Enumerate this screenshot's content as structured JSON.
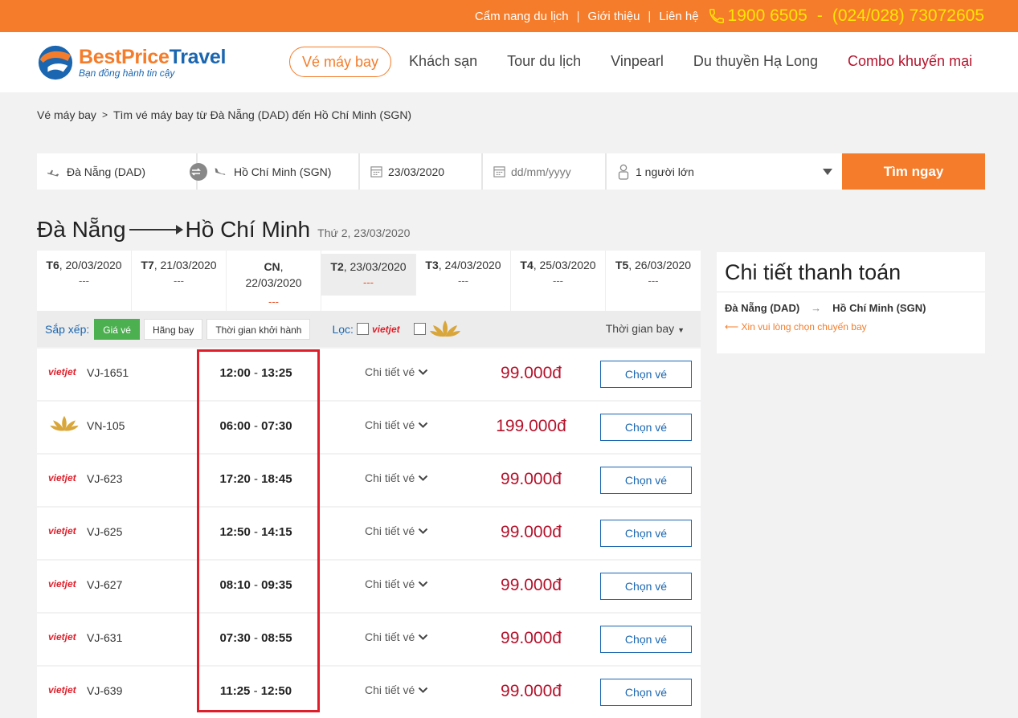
{
  "topbar": {
    "links": [
      "Cẩm nang du lịch",
      "Giới thiệu",
      "Liên hệ"
    ],
    "phone1": "1900 6505",
    "phone_sep": "-",
    "phone2": "(024/028) 73072605"
  },
  "brand": {
    "name_part1": "BestPrice",
    "name_part2": "Travel",
    "tagline": "Bạn đồng hành tin cậy"
  },
  "nav": [
    "Vé máy bay",
    "Khách sạn",
    "Tour du lịch",
    "Vinpearl",
    "Du thuyền Hạ Long",
    "Combo khuyến mại"
  ],
  "breadcrumb": {
    "root": "Vé máy bay",
    "current": "Tìm vé máy bay từ Đà Nẵng (DAD) đến Hồ Chí Minh (SGN)"
  },
  "search": {
    "from": "Đà Nẵng (DAD)",
    "to": "Hồ Chí Minh (SGN)",
    "depart_date": "23/03/2020",
    "return_placeholder": "dd/mm/yyyy",
    "passengers": "1 người lớn",
    "button": "Tìm ngay"
  },
  "route": {
    "from": "Đà Nẵng",
    "to": "Hồ Chí Minh",
    "date": "Thứ 2, 23/03/2020"
  },
  "date_tabs": [
    {
      "day": "T6",
      "date": ", 20/03/2020",
      "price": "---"
    },
    {
      "day": "T7",
      "date": ", 21/03/2020",
      "price": "---"
    },
    {
      "day": "CN",
      "date": "22/03/2020",
      "price": "---"
    },
    {
      "day": "T2",
      "date": ", 23/03/2020",
      "price": "---"
    },
    {
      "day": "T3",
      "date": ", 24/03/2020",
      "price": "---"
    },
    {
      "day": "T4",
      "date": ", 25/03/2020",
      "price": "---"
    },
    {
      "day": "T5",
      "date": ", 26/03/2020",
      "price": "---"
    }
  ],
  "filters": {
    "sort_label": "Sắp xếp:",
    "sort_price": "Giá vé",
    "sort_airline": "Hãng bay",
    "sort_time": "Thời gian khởi hành",
    "filter_label": "Lọc:",
    "vietjet_logo": "vietjet",
    "flight_time": "Thời gian bay"
  },
  "flights": [
    {
      "airline": "vietjet",
      "code": "VJ-1651",
      "dep": "12:00",
      "arr": "13:25",
      "price": "99.000đ"
    },
    {
      "airline": "vietnam-airlines",
      "code": "VN-105",
      "dep": "06:00",
      "arr": "07:30",
      "price": "199.000đ"
    },
    {
      "airline": "vietjet",
      "code": "VJ-623",
      "dep": "17:20",
      "arr": "18:45",
      "price": "99.000đ"
    },
    {
      "airline": "vietjet",
      "code": "VJ-625",
      "dep": "12:50",
      "arr": "14:15",
      "price": "99.000đ"
    },
    {
      "airline": "vietjet",
      "code": "VJ-627",
      "dep": "08:10",
      "arr": "09:35",
      "price": "99.000đ"
    },
    {
      "airline": "vietjet",
      "code": "VJ-631",
      "dep": "07:30",
      "arr": "08:55",
      "price": "99.000đ"
    },
    {
      "airline": "vietjet",
      "code": "VJ-639",
      "dep": "11:25",
      "arr": "12:50",
      "price": "99.000đ"
    }
  ],
  "flight_labels": {
    "detail": "Chi tiết vé",
    "choose": "Chọn vé",
    "time_sep": "-"
  },
  "payment": {
    "title": "Chi tiết thanh toán",
    "from": "Đà Nẵng (DAD)",
    "to": "Hồ Chí Minh (SGN)",
    "note": "⟵ Xin vui lòng chọn chuyến bay"
  },
  "colors": {
    "brand_orange": "#f47c2a",
    "brand_blue": "#1a66b0",
    "price_red": "#b5122b",
    "highlight_red": "#e01e2a"
  }
}
